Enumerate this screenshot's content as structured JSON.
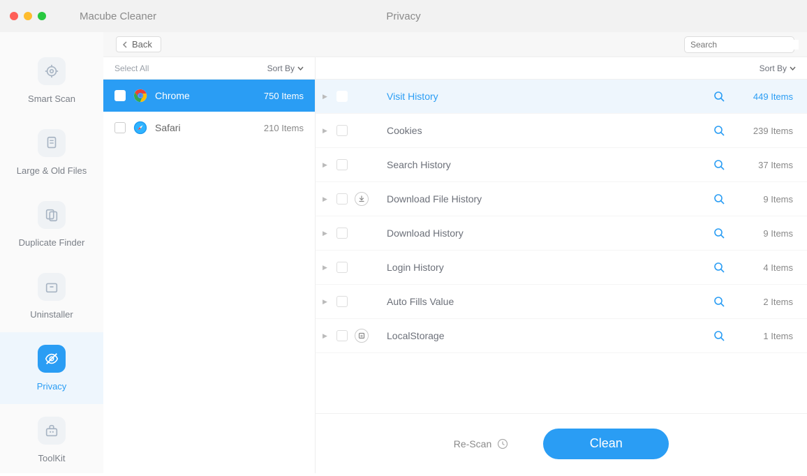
{
  "app_title": "Macube Cleaner",
  "page_title": "Privacy",
  "back_label": "Back",
  "search_placeholder": "Search",
  "select_all_label": "Select All",
  "sort_by_label": "Sort By",
  "rescan_label": "Re-Scan",
  "clean_label": "Clean",
  "sidebar": [
    {
      "icon": "target",
      "label": "Smart Scan",
      "active": false
    },
    {
      "icon": "files",
      "label": "Large & Old Files",
      "active": false
    },
    {
      "icon": "duplicate",
      "label": "Duplicate Finder",
      "active": false
    },
    {
      "icon": "box",
      "label": "Uninstaller",
      "active": false
    },
    {
      "icon": "eye-off",
      "label": "Privacy",
      "active": true
    },
    {
      "icon": "toolkit",
      "label": "ToolKit",
      "active": false
    }
  ],
  "browsers": [
    {
      "name": "Chrome",
      "count": "750 Items",
      "selected": true,
      "icon": "chrome"
    },
    {
      "name": "Safari",
      "count": "210 Items",
      "selected": false,
      "icon": "safari"
    }
  ],
  "details": [
    {
      "name": "Visit History",
      "count": "449 Items",
      "highlighted": true,
      "extra_icon": null
    },
    {
      "name": "Cookies",
      "count": "239 Items",
      "highlighted": false,
      "extra_icon": null
    },
    {
      "name": "Search History",
      "count": "37 Items",
      "highlighted": false,
      "extra_icon": null
    },
    {
      "name": "Download File History",
      "count": "9 Items",
      "highlighted": false,
      "extra_icon": "download"
    },
    {
      "name": "Download History",
      "count": "9 Items",
      "highlighted": false,
      "extra_icon": null
    },
    {
      "name": "Login History",
      "count": "4 Items",
      "highlighted": false,
      "extra_icon": null
    },
    {
      "name": "Auto Fills Value",
      "count": "2 Items",
      "highlighted": false,
      "extra_icon": null
    },
    {
      "name": "LocalStorage",
      "count": "1 Items",
      "highlighted": false,
      "extra_icon": "storage"
    }
  ]
}
